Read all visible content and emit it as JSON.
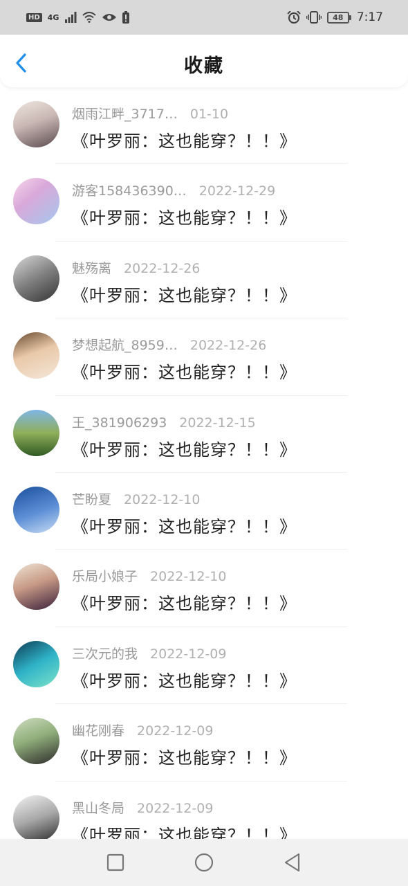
{
  "status_bar": {
    "hd": "HD",
    "network": "4G",
    "battery": "48",
    "time": "7:17"
  },
  "header": {
    "title": "收藏"
  },
  "items": [
    {
      "user": "烟雨江畔_3717…",
      "date": "01-10",
      "title": "《叶罗丽：这也能穿？！！》",
      "avatar_bg": "linear-gradient(160deg,#efe6e0 0%,#c9b8b4 45%,#5b4a4e 100%)"
    },
    {
      "user": "游客158436390…",
      "date": "2022-12-29",
      "title": "《叶罗丽：这也能穿？！！》",
      "avatar_bg": "linear-gradient(140deg,#f7d8ec 0%,#d9a8d9 40%,#a3c8ee 100%)"
    },
    {
      "user": "魅殇离",
      "date": "2022-12-26",
      "title": "《叶罗丽：这也能穿？！！》",
      "avatar_bg": "linear-gradient(150deg,#d8d8d8 0%,#7f7f7f 50%,#333 100%)"
    },
    {
      "user": "梦想起航_8959…",
      "date": "2022-12-26",
      "title": "《叶罗丽：这也能穿？！！》",
      "avatar_bg": "linear-gradient(160deg,#6a4a2e 0%,#e9c9a9 45%,#f4e6d8 100%)"
    },
    {
      "user": "王_381906293",
      "date": "2022-12-15",
      "title": "《叶罗丽：这也能穿？！！》",
      "avatar_bg": "linear-gradient(180deg,#7fb6e6 0%,#8fae5a 50%,#2f5a23 100%)"
    },
    {
      "user": "芒盼夏",
      "date": "2022-12-10",
      "title": "《叶罗丽：这也能穿？！！》",
      "avatar_bg": "linear-gradient(160deg,#1b4f9c 0%,#5d8fd6 55%,#c8dcf3 100%)"
    },
    {
      "user": "乐局小娘子",
      "date": "2022-12-10",
      "title": "《叶罗丽：这也能穿？！！》",
      "avatar_bg": "linear-gradient(160deg,#efe4d4 0%,#c79a86 45%,#3a1f3a 100%)"
    },
    {
      "user": "三次元的我",
      "date": "2022-12-09",
      "title": "《叶罗丽：这也能穿？！！》",
      "avatar_bg": "linear-gradient(150deg,#0d3a52 0%,#2fb3c8 50%,#7fe3c8 100%)"
    },
    {
      "user": "幽花刚春",
      "date": "2022-12-09",
      "title": "《叶罗丽：这也能穿？！！》",
      "avatar_bg": "linear-gradient(160deg,#cfdcc0 0%,#8fae7a 45%,#2d2a2a 100%)"
    },
    {
      "user": "黑山冬局",
      "date": "2022-12-09",
      "title": "《叶罗丽：这也能穿？！！》",
      "avatar_bg": "linear-gradient(160deg,#f2f2f2 0%,#a8a8a8 50%,#2a2a2a 100%)"
    }
  ],
  "colors": {
    "accent": "#1e8ee8",
    "title": "#1a1a1a",
    "meta": "#9a9a9a"
  },
  "icons": {
    "back": "chevron-left-icon",
    "nav_recent": "square-icon",
    "nav_home": "circle-icon",
    "nav_back": "triangle-left-icon"
  }
}
